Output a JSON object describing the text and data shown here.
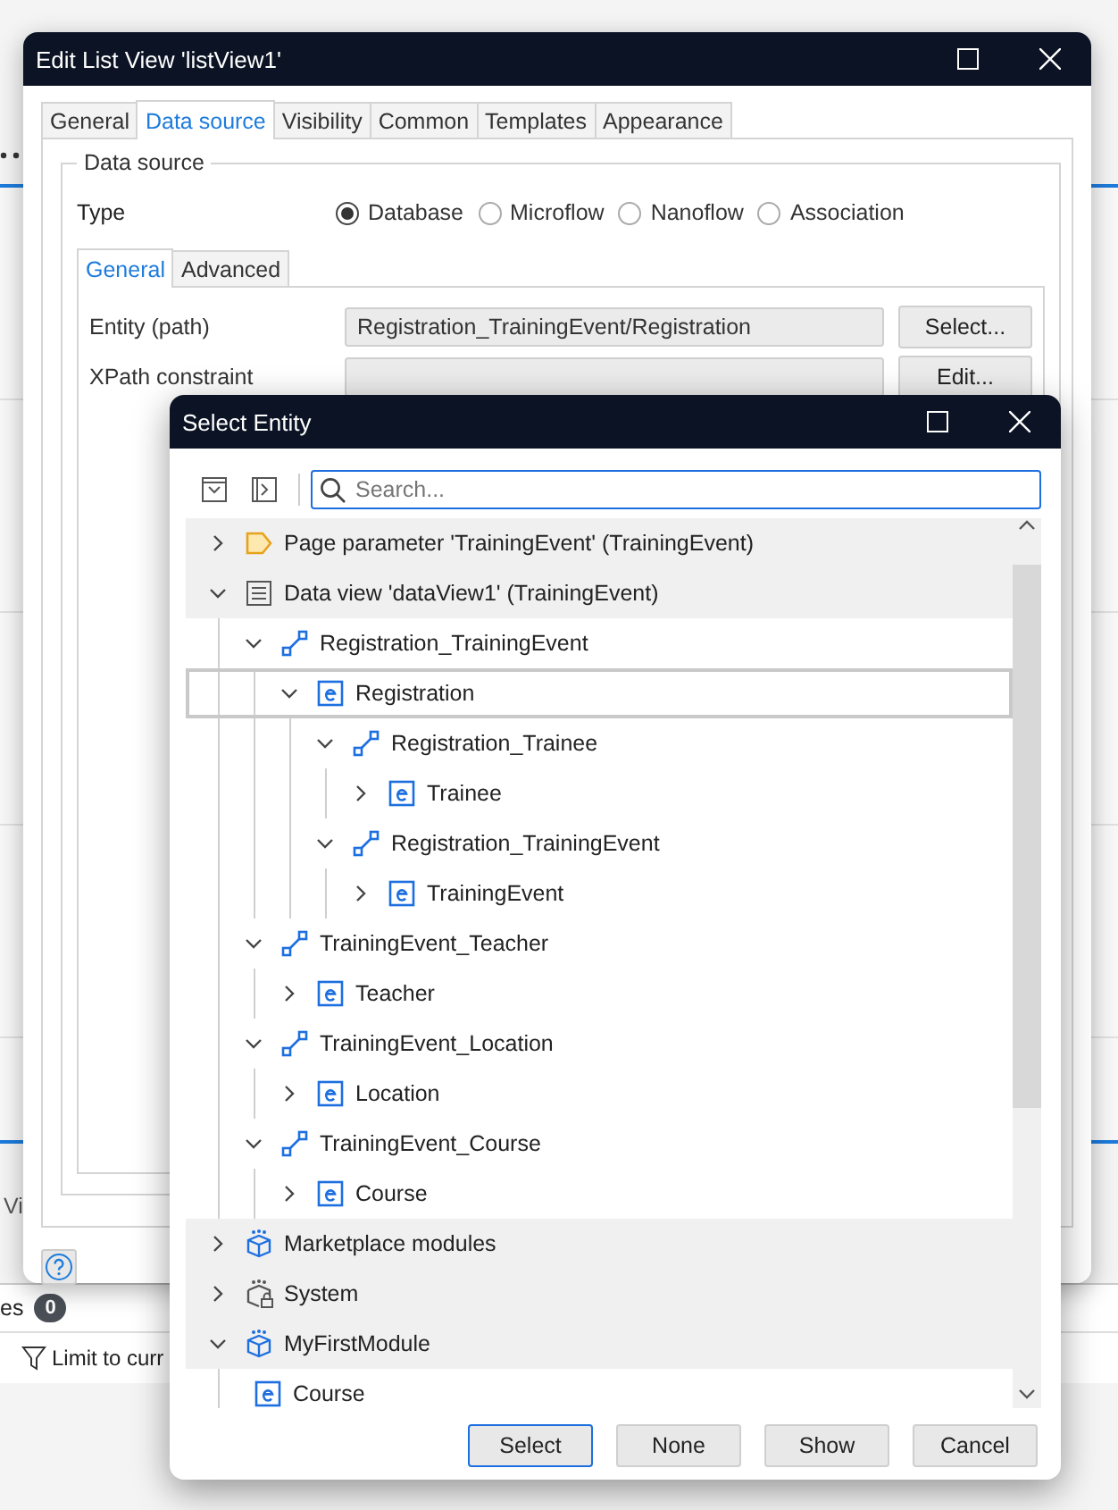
{
  "background": {
    "side_tab": "Vi",
    "panel_label": "es",
    "badge": "0",
    "filter": "Limit to curr"
  },
  "edit_dialog": {
    "title": "Edit List View 'listView1'",
    "tabs": [
      {
        "label": "General",
        "selected": false
      },
      {
        "label": "Data source",
        "selected": true
      },
      {
        "label": "Visibility",
        "selected": false
      },
      {
        "label": "Common",
        "selected": false
      },
      {
        "label": "Templates",
        "selected": false
      },
      {
        "label": "Appearance",
        "selected": false
      }
    ],
    "group_title": "Data source",
    "type_label": "Type",
    "type_options": [
      {
        "label": "Database",
        "selected": true
      },
      {
        "label": "Microflow",
        "selected": false
      },
      {
        "label": "Nanoflow",
        "selected": false
      },
      {
        "label": "Association",
        "selected": false
      }
    ],
    "inner_tabs": [
      {
        "label": "General",
        "selected": true
      },
      {
        "label": "Advanced",
        "selected": false
      }
    ],
    "fields": [
      {
        "label": "Entity (path)",
        "value": "Registration_TrainingEvent/Registration",
        "button": "Select..."
      },
      {
        "label": "XPath constraint",
        "button": "Edit..."
      }
    ]
  },
  "select_dialog": {
    "title": "Select Entity",
    "search": {
      "placeholder": "Search..."
    },
    "tree": [
      {
        "label": "Page parameter 'TrainingEvent' (TrainingEvent)",
        "kind": "parameter",
        "expanded": false,
        "selected": false
      },
      {
        "label": "Data view 'dataView1' (TrainingEvent)",
        "kind": "dataview",
        "expanded": true,
        "selected": false,
        "children": [
          {
            "label": "Registration_TrainingEvent",
            "kind": "association",
            "expanded": true,
            "selected": false,
            "children": [
              {
                "label": "Registration",
                "kind": "entity",
                "expanded": true,
                "selected": true,
                "children": [
                  {
                    "label": "Registration_Trainee",
                    "kind": "association",
                    "expanded": true,
                    "selected": false,
                    "children": [
                      {
                        "label": "Trainee",
                        "kind": "entity",
                        "expanded": false,
                        "selected": false
                      }
                    ]
                  },
                  {
                    "label": "Registration_TrainingEvent",
                    "kind": "association",
                    "expanded": true,
                    "selected": false,
                    "children": [
                      {
                        "label": "TrainingEvent",
                        "kind": "entity",
                        "expanded": false,
                        "selected": false
                      }
                    ]
                  }
                ]
              }
            ]
          },
          {
            "label": "TrainingEvent_Teacher",
            "kind": "association",
            "expanded": true,
            "selected": false,
            "children": [
              {
                "label": "Teacher",
                "kind": "entity",
                "expanded": false,
                "selected": false
              }
            ]
          },
          {
            "label": "TrainingEvent_Location",
            "kind": "association",
            "expanded": true,
            "selected": false,
            "children": [
              {
                "label": "Location",
                "kind": "entity",
                "expanded": false,
                "selected": false
              }
            ]
          },
          {
            "label": "TrainingEvent_Course",
            "kind": "association",
            "expanded": true,
            "selected": false,
            "children": [
              {
                "label": "Course",
                "kind": "entity",
                "expanded": false,
                "selected": false
              }
            ]
          }
        ]
      },
      {
        "label": "Marketplace modules",
        "kind": "module",
        "expanded": false,
        "selected": false
      },
      {
        "label": "System",
        "kind": "system",
        "expanded": false,
        "selected": false
      },
      {
        "label": "MyFirstModule",
        "kind": "module",
        "expanded": true,
        "selected": false,
        "children": [
          {
            "label": "Course",
            "kind": "entity",
            "selected": false
          }
        ]
      }
    ],
    "buttons": [
      {
        "label": "Select",
        "default": true
      },
      {
        "label": "None",
        "default": false
      },
      {
        "label": "Show",
        "default": false
      },
      {
        "label": "Cancel",
        "default": false
      }
    ]
  }
}
